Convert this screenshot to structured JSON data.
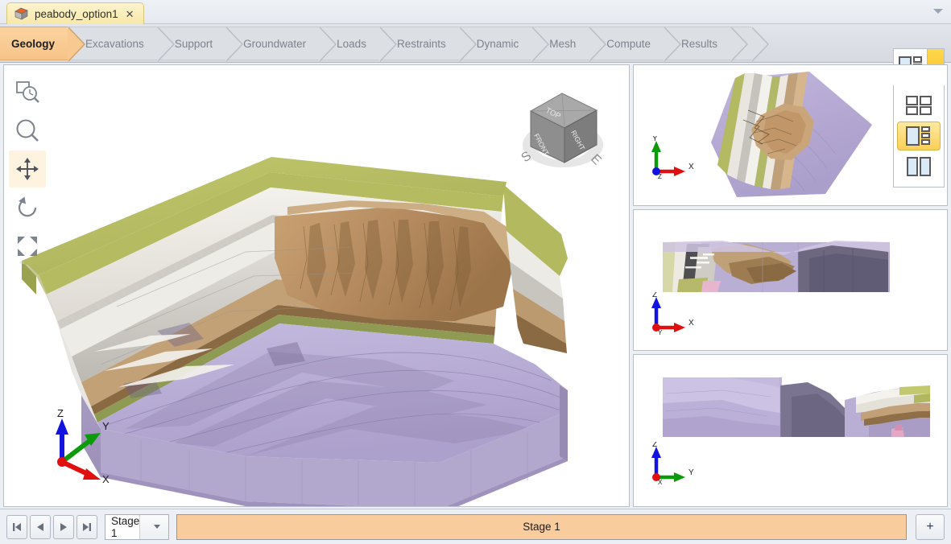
{
  "window": {
    "document_tab": {
      "title": "peabody_option1",
      "icon": "geology-block-icon",
      "close_label": "✕"
    },
    "overflow_chevron_icon": "chevron-down-icon"
  },
  "workflow_tabs": [
    {
      "label": "Geology",
      "active": true
    },
    {
      "label": "Excavations",
      "active": false
    },
    {
      "label": "Support",
      "active": false
    },
    {
      "label": "Groundwater",
      "active": false
    },
    {
      "label": "Loads",
      "active": false
    },
    {
      "label": "Restraints",
      "active": false
    },
    {
      "label": "Dynamic",
      "active": false
    },
    {
      "label": "Mesh",
      "active": false
    },
    {
      "label": "Compute",
      "active": false
    },
    {
      "label": "Results",
      "active": false
    }
  ],
  "layout_control": {
    "button_icon": "layout-one-plus-three-icon",
    "dropdown_arrow_icon": "chevron-down-icon",
    "expanded": true,
    "options": [
      {
        "name": "layout-2x2-grid",
        "selected": false
      },
      {
        "name": "layout-one-plus-three",
        "selected": true
      },
      {
        "name": "layout-two-panel-split",
        "selected": false
      }
    ]
  },
  "view_tools": [
    {
      "name": "zoom-window-icon",
      "active": false
    },
    {
      "name": "zoom-icon",
      "active": false
    },
    {
      "name": "pan-icon",
      "active": true
    },
    {
      "name": "rotate-icon",
      "active": false
    },
    {
      "name": "zoom-extents-icon",
      "active": false
    }
  ],
  "main_viewport": {
    "name": "perspective-3d-view",
    "nav_cube": {
      "faces": {
        "top": "TOP",
        "front": "FRONT",
        "right": "RIGHT"
      },
      "compass": {
        "south": "S",
        "east": "E"
      }
    },
    "axis_triad": {
      "x": "X",
      "y": "Y",
      "z": "Z"
    },
    "model_colors": {
      "topsoil_olive": "#b9bf63",
      "limestone_white": "#f1efe9",
      "shale_gray": "#c9c7c2",
      "sandstone_tan": "#bb9467",
      "coal_brown": "#9d7a4f",
      "basement_lavender": "#b3a8cf",
      "basement_shadow": "#9b90bb"
    }
  },
  "side_panels": [
    {
      "name": "plan-view-panel",
      "axis_triad": {
        "horizontal": "X",
        "vertical": "Y",
        "out_of_page": "Z"
      }
    },
    {
      "name": "front-elevation-panel",
      "axis_triad": {
        "horizontal": "X",
        "vertical": "Z",
        "out_of_page": "Y"
      }
    },
    {
      "name": "side-elevation-panel",
      "axis_triad": {
        "horizontal": "Y",
        "vertical": "Z",
        "out_of_page": "X"
      }
    }
  ],
  "stage_bar": {
    "first_icon": "skip-to-first-icon",
    "prev_icon": "step-back-icon",
    "next_icon": "step-forward-icon",
    "last_icon": "skip-to-last-icon",
    "selected_stage": "Stage 1",
    "stage_chip_label": "Stage 1",
    "add_label": "+"
  }
}
